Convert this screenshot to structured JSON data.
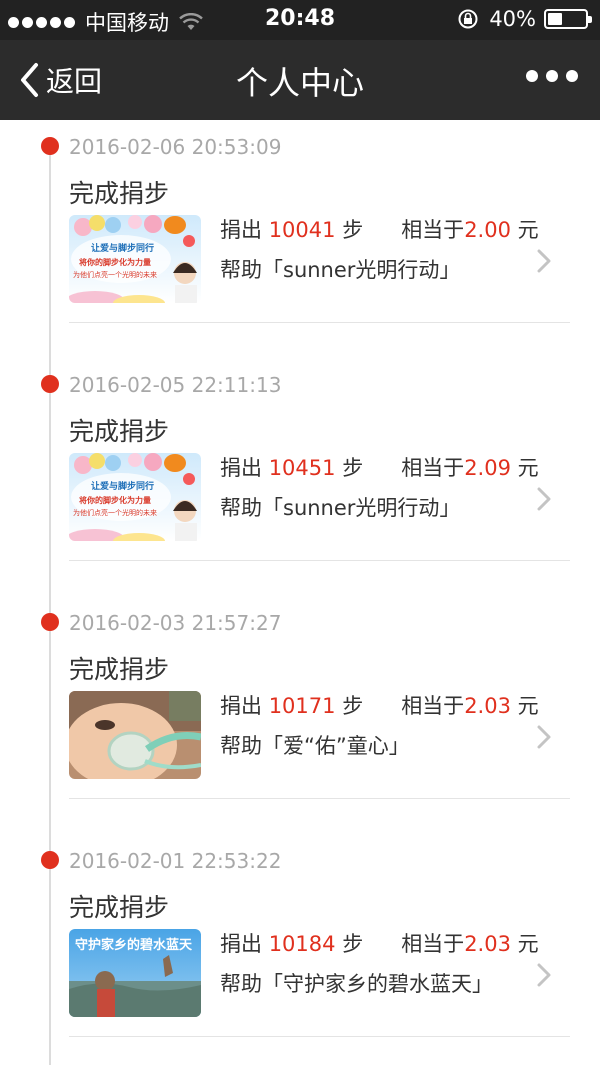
{
  "status_bar": {
    "carrier": "中国移动",
    "time": "20:48",
    "battery": "40%",
    "battery_level": 0.4
  },
  "nav": {
    "back_label": "返回",
    "title": "个人中心"
  },
  "labels": {
    "donate_prefix": "捐出",
    "steps_unit": "步",
    "equivalent": "相当于",
    "yuan": "元",
    "help_prefix": "帮助",
    "quote_open": "「",
    "quote_close": "」"
  },
  "entries": [
    {
      "time": "2016-02-06 20:53:09",
      "title": "完成捐步",
      "steps": "10041",
      "amount": "2.00",
      "project": "sunner光明行动",
      "thumb_icon": "sunner-campaign-thumbnail",
      "thumb_text": [
        "让爱与脚步同行",
        "将你的脚步化为力量",
        "为他们点亮一个光明的未来"
      ]
    },
    {
      "time": "2016-02-05 22:11:13",
      "title": "完成捐步",
      "steps": "10451",
      "amount": "2.09",
      "project": "sunner光明行动",
      "thumb_icon": "sunner-campaign-thumbnail",
      "thumb_text": [
        "让爱与脚步同行",
        "将你的脚步化为力量",
        "为他们点亮一个光明的未来"
      ]
    },
    {
      "time": "2016-02-03 21:57:27",
      "title": "完成捐步",
      "steps": "10171",
      "amount": "2.03",
      "project": "爱“佑”童心",
      "thumb_icon": "baby-oxygen-mask-photo",
      "thumb_text": []
    },
    {
      "time": "2016-02-01 22:53:22",
      "title": "完成捐步",
      "steps": "10184",
      "amount": "2.03",
      "project": "守护家乡的碧水蓝天",
      "thumb_icon": "blue-sky-campaign-photo",
      "thumb_text": [
        "守护家乡的碧水蓝天"
      ]
    }
  ],
  "colors": {
    "accent_red": "#e0301e",
    "nav_bg": "#2c2c2c",
    "status_bg": "#222222",
    "timestamp_gray": "#a8a8a8"
  }
}
